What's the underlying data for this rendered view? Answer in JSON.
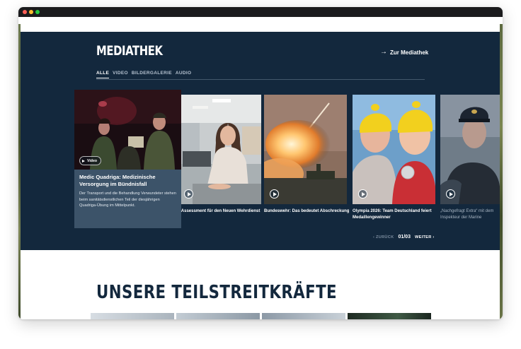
{
  "mediathek": {
    "title": "MEDIATHEK",
    "link_label": "Zur Mediathek",
    "tabs": [
      {
        "label": "ALLE",
        "active": true
      },
      {
        "label": "VIDEO",
        "active": false
      },
      {
        "label": "BILDERGALERIE",
        "active": false
      },
      {
        "label": "AUDIO",
        "active": false
      }
    ],
    "featured": {
      "badge": "Video",
      "title": "Medic Quadriga: Medizinische Versorgung im Bündnisfall",
      "description": "Der Transport und die Behandlung Verwundeter stehen beim sanitätsdienstlichen Teil der diesjährigen Quadriga-Übung im Mittelpunkt."
    },
    "cards": [
      {
        "caption": "s Assessment für den Neuen Wehrdienst"
      },
      {
        "caption": "Bundeswehr: Das bedeutet Abschreckung"
      },
      {
        "caption": "Olympia 2026: Team Deutschland feiert Medaillengewinner"
      },
      {
        "caption": "„Nachgefragt Extra“ mit dem Inspekteur der Marine"
      }
    ],
    "pager": {
      "prev": "ZURÜCK",
      "count": "01/03",
      "next": "WEITER"
    }
  },
  "branches": {
    "title": "UNSERE TEILSTREITKRÄFTE"
  },
  "colors": {
    "media_bg": "#13283d",
    "featured_bg": "#3c5369",
    "heading": "#13283d"
  }
}
